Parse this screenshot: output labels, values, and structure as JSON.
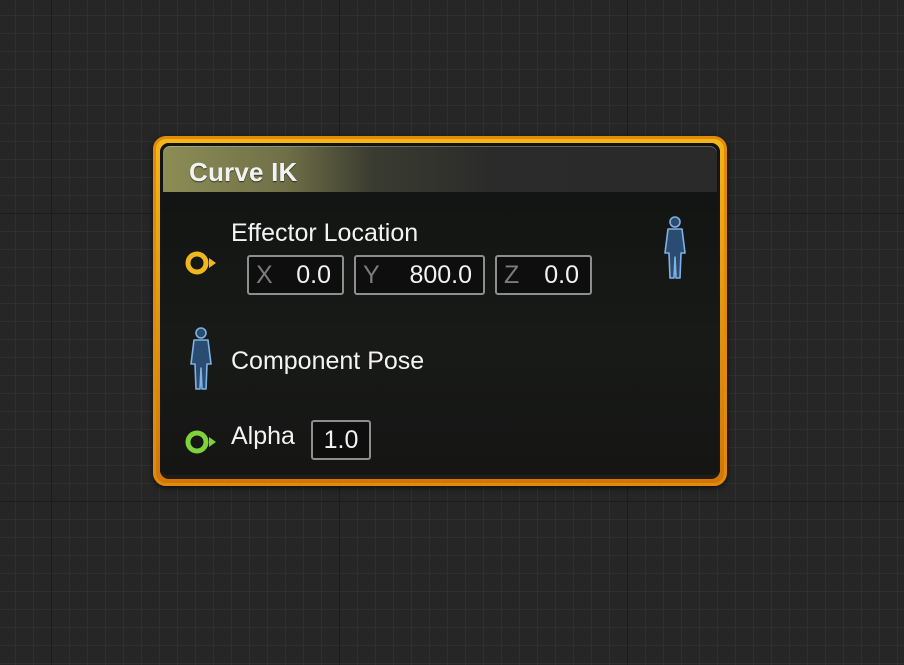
{
  "node": {
    "title": "Curve IK",
    "colors": {
      "border": "#e28a0b",
      "header_tint": "#8c8d55",
      "vector_pin": "#f0b81e",
      "float_pin": "#7fd23a",
      "pose_pin": "#6fa3d6"
    },
    "effector": {
      "label": "Effector Location",
      "icon": "vector-pin-icon",
      "x_letter": "X",
      "x_value": "0.0",
      "y_letter": "Y",
      "y_value": "800.0",
      "z_letter": "Z",
      "z_value": "0.0"
    },
    "output_pose_icon": "pose-output-pin-icon",
    "component_pose": {
      "label": "Component Pose",
      "icon": "pose-input-pin-icon"
    },
    "alpha": {
      "label": "Alpha",
      "icon": "float-pin-icon",
      "value": "1.0"
    }
  }
}
